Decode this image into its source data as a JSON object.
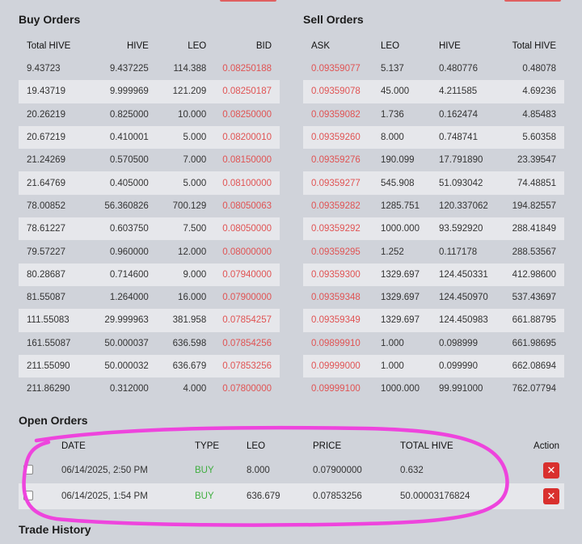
{
  "buy": {
    "title": "Buy Orders",
    "headers": [
      "Total HIVE",
      "HIVE",
      "LEO",
      "BID"
    ],
    "rows": [
      [
        "9.43723",
        "9.437225",
        "114.388",
        "0.08250188"
      ],
      [
        "19.43719",
        "9.999969",
        "121.209",
        "0.08250187"
      ],
      [
        "20.26219",
        "0.825000",
        "10.000",
        "0.08250000"
      ],
      [
        "20.67219",
        "0.410001",
        "5.000",
        "0.08200010"
      ],
      [
        "21.24269",
        "0.570500",
        "7.000",
        "0.08150000"
      ],
      [
        "21.64769",
        "0.405000",
        "5.000",
        "0.08100000"
      ],
      [
        "78.00852",
        "56.360826",
        "700.129",
        "0.08050063"
      ],
      [
        "78.61227",
        "0.603750",
        "7.500",
        "0.08050000"
      ],
      [
        "79.57227",
        "0.960000",
        "12.000",
        "0.08000000"
      ],
      [
        "80.28687",
        "0.714600",
        "9.000",
        "0.07940000"
      ],
      [
        "81.55087",
        "1.264000",
        "16.000",
        "0.07900000"
      ],
      [
        "111.55083",
        "29.999963",
        "381.958",
        "0.07854257"
      ],
      [
        "161.55087",
        "50.000037",
        "636.598",
        "0.07854256"
      ],
      [
        "211.55090",
        "50.000032",
        "636.679",
        "0.07853256"
      ],
      [
        "211.86290",
        "0.312000",
        "4.000",
        "0.07800000"
      ]
    ]
  },
  "sell": {
    "title": "Sell Orders",
    "headers": [
      "ASK",
      "LEO",
      "HIVE",
      "Total HIVE"
    ],
    "rows": [
      [
        "0.09359077",
        "5.137",
        "0.480776",
        "0.48078"
      ],
      [
        "0.09359078",
        "45.000",
        "4.211585",
        "4.69236"
      ],
      [
        "0.09359082",
        "1.736",
        "0.162474",
        "4.85483"
      ],
      [
        "0.09359260",
        "8.000",
        "0.748741",
        "5.60358"
      ],
      [
        "0.09359276",
        "190.099",
        "17.791890",
        "23.39547"
      ],
      [
        "0.09359277",
        "545.908",
        "51.093042",
        "74.48851"
      ],
      [
        "0.09359282",
        "1285.751",
        "120.337062",
        "194.82557"
      ],
      [
        "0.09359292",
        "1000.000",
        "93.592920",
        "288.41849"
      ],
      [
        "0.09359295",
        "1.252",
        "0.117178",
        "288.53567"
      ],
      [
        "0.09359300",
        "1329.697",
        "124.450331",
        "412.98600"
      ],
      [
        "0.09359348",
        "1329.697",
        "124.450970",
        "537.43697"
      ],
      [
        "0.09359349",
        "1329.697",
        "124.450983",
        "661.88795"
      ],
      [
        "0.09899910",
        "1.000",
        "0.098999",
        "661.98695"
      ],
      [
        "0.09999000",
        "1.000",
        "0.099990",
        "662.08694"
      ],
      [
        "0.09999100",
        "1000.000",
        "99.991000",
        "762.07794"
      ]
    ]
  },
  "open": {
    "title": "Open Orders",
    "headers": [
      "DATE",
      "TYPE",
      "LEO",
      "PRICE",
      "TOTAL HIVE",
      "Action"
    ],
    "rows": [
      {
        "date": "06/14/2025, 2:50 PM",
        "type": "BUY",
        "leo": "8.000",
        "price": "0.07900000",
        "total": "0.632",
        "action": "✕"
      },
      {
        "date": "06/14/2025, 1:54 PM",
        "type": "BUY",
        "leo": "636.679",
        "price": "0.07853256",
        "total": "50.00003176824",
        "action": "✕"
      }
    ]
  },
  "trade_history": {
    "title": "Trade History"
  },
  "colors": {
    "bid_ask": "#e05353",
    "buy": "#3fae3f",
    "cancel": "#d9302e",
    "highlight": "#ee44dd"
  }
}
